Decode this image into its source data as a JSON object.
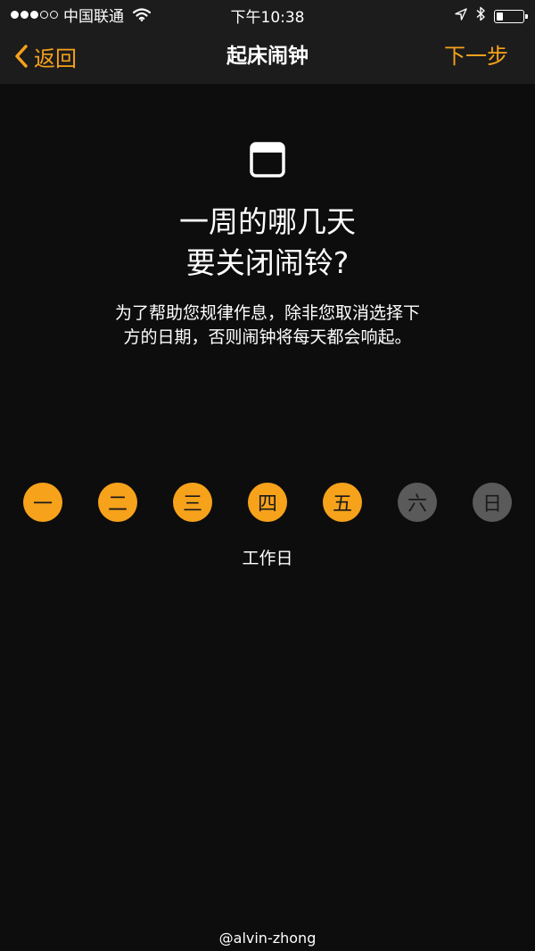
{
  "status_bar": {
    "signal_full": 3,
    "signal_empty": 2,
    "carrier": "中国联通",
    "time": "下午10:38",
    "battery_level": 0.25
  },
  "nav": {
    "back_label": "返回",
    "title": "起床闹钟",
    "next_label": "下一步",
    "accent_color": "#f7a21b"
  },
  "content": {
    "icon": "calendar-icon",
    "heading_line1": "一周的哪几天",
    "heading_line2": "要关闭闹铃?",
    "description": "为了帮助您规律作息，除非您取消选择下方的日期，否则闹钟将每天都会响起。",
    "days": [
      {
        "label": "一",
        "selected": true
      },
      {
        "label": "二",
        "selected": true
      },
      {
        "label": "三",
        "selected": true
      },
      {
        "label": "四",
        "selected": true
      },
      {
        "label": "五",
        "selected": true
      },
      {
        "label": "六",
        "selected": false
      },
      {
        "label": "日",
        "selected": false
      }
    ],
    "selection_summary": "工作日"
  },
  "watermark": "@alvin-zhong"
}
